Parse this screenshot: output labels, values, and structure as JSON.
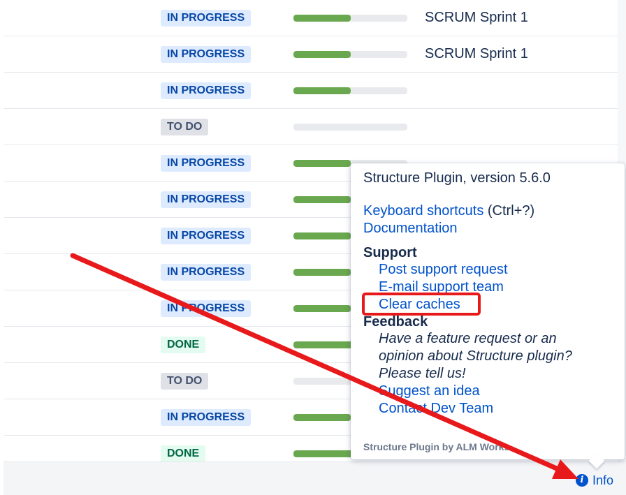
{
  "grid": {
    "rows": [
      {
        "status": "IN PROGRESS",
        "kind": "inprogress",
        "progress": 0.5,
        "sprint": "SCRUM Sprint 1"
      },
      {
        "status": "IN PROGRESS",
        "kind": "inprogress",
        "progress": 0.5,
        "sprint": "SCRUM Sprint 1"
      },
      {
        "status": "IN PROGRESS",
        "kind": "inprogress",
        "progress": 0.5,
        "sprint": ""
      },
      {
        "status": "TO DO",
        "kind": "todo",
        "progress": 0.0,
        "sprint": ""
      },
      {
        "status": "IN PROGRESS",
        "kind": "inprogress",
        "progress": 0.5,
        "sprint": ""
      },
      {
        "status": "IN PROGRESS",
        "kind": "inprogress",
        "progress": 0.5,
        "sprint": ""
      },
      {
        "status": "IN PROGRESS",
        "kind": "inprogress",
        "progress": 0.5,
        "sprint": ""
      },
      {
        "status": "IN PROGRESS",
        "kind": "inprogress",
        "progress": 0.5,
        "sprint": ""
      },
      {
        "status": "IN PROGRESS",
        "kind": "inprogress",
        "progress": 0.5,
        "sprint": ""
      },
      {
        "status": "DONE",
        "kind": "done",
        "progress": 1.0,
        "sprint": ""
      },
      {
        "status": "TO DO",
        "kind": "todo",
        "progress": 0.0,
        "sprint": ""
      },
      {
        "status": "IN PROGRESS",
        "kind": "inprogress",
        "progress": 0.5,
        "sprint": ""
      },
      {
        "status": "DONE",
        "kind": "done",
        "progress": 1.0,
        "sprint": ""
      }
    ]
  },
  "popup": {
    "title": "Structure Plugin, version 5.6.0",
    "keyboard_shortcuts": "Keyboard shortcuts",
    "keyboard_shortcuts_hint": "(Ctrl+?)",
    "documentation": "Documentation",
    "support_heading": "Support",
    "post_support_request": "Post support request",
    "email_support_team": "E-mail support team",
    "clear_caches": "Clear caches",
    "feedback_heading": "Feedback",
    "feedback_text_1": "Have a feature request or an",
    "feedback_text_2": "opinion about Structure plugin?",
    "feedback_text_3": "Please tell us!",
    "suggest_idea": "Suggest an idea",
    "contact_dev_team": "Contact Dev Team",
    "footer": "Structure Plugin by ALM Works"
  },
  "footer": {
    "info_label": "Info",
    "info_icon": "info-circle-icon"
  },
  "colors": {
    "link": "#0052cc",
    "progress_fill": "#6aa84f",
    "annotation_red": "#e8191b"
  }
}
